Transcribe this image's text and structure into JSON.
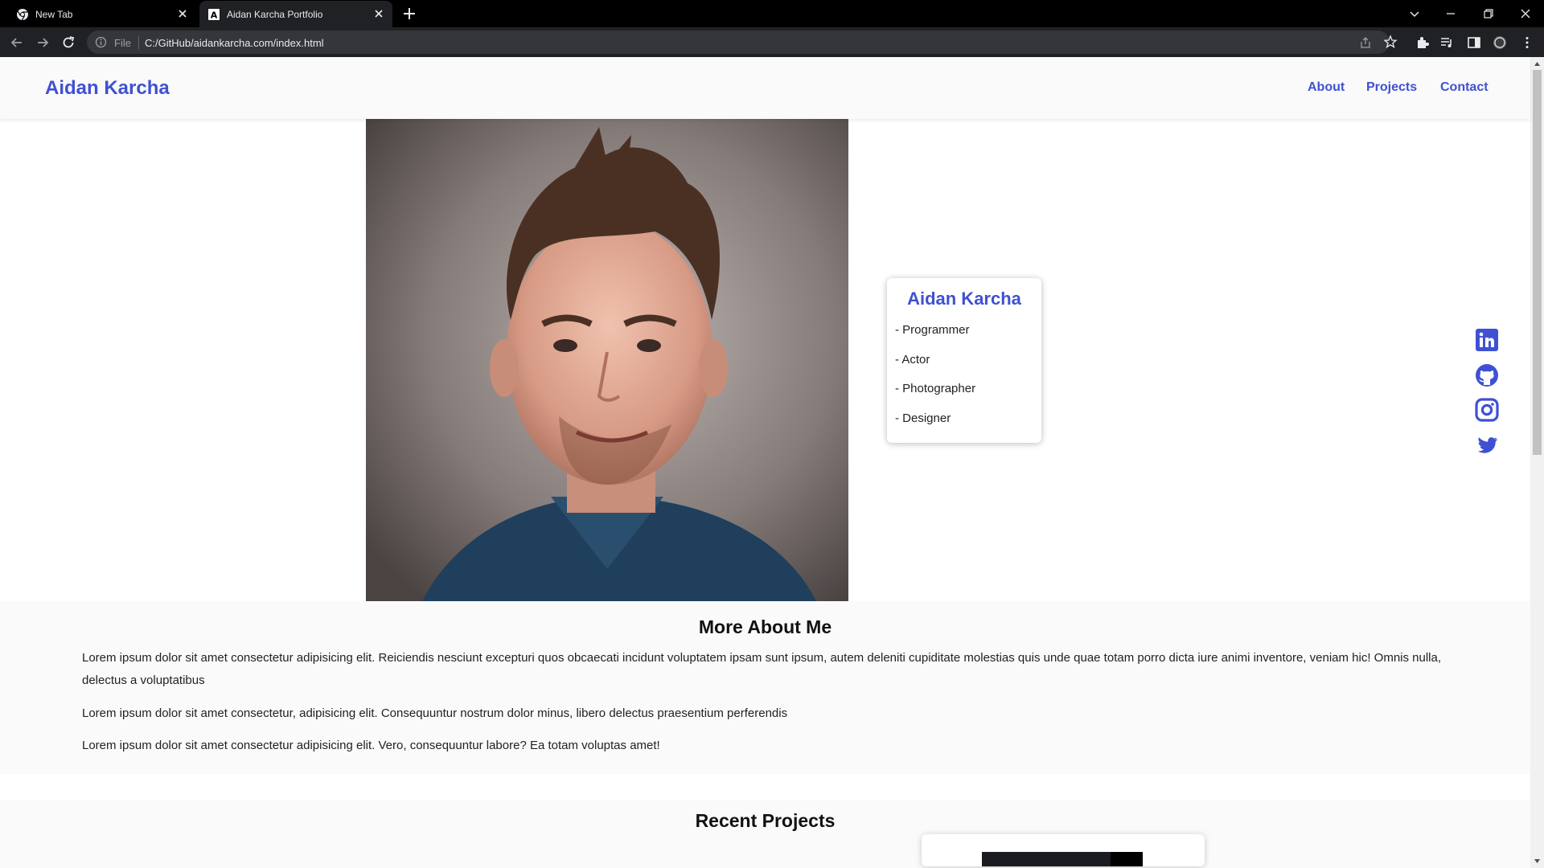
{
  "browser": {
    "tabs": [
      {
        "title": "New Tab",
        "active": false
      },
      {
        "title": "Aidan Karcha Portfolio",
        "active": true
      }
    ],
    "address": {
      "scheme_label": "File",
      "url": "C:/GitHub/aidankarcha.com/index.html"
    }
  },
  "site": {
    "brand": "Aidan Karcha",
    "nav": [
      "About",
      "Projects",
      "Contact"
    ],
    "card": {
      "name": "Aidan Karcha",
      "roles": [
        "- Programmer",
        "- Actor",
        "- Photographer",
        "- Designer"
      ]
    },
    "social": [
      "linkedin-icon",
      "github-icon",
      "instagram-icon",
      "twitter-icon"
    ],
    "about": {
      "title": "More About Me",
      "paragraphs": [
        "Lorem ipsum dolor sit amet consectetur adipisicing elit. Reiciendis nesciunt excepturi quos obcaecati incidunt voluptatem ipsam sunt ipsum, autem deleniti cupiditate molestias quis unde quae totam porro dicta iure animi inventore, veniam hic! Omnis nulla, delectus a voluptatibus",
        "Lorem ipsum dolor sit amet consectetur, adipisicing elit. Consequuntur nostrum dolor minus, libero delectus praesentium perferendis",
        "Lorem ipsum dolor sit amet consectetur adipisicing elit. Vero, consequuntur labore? Ea totam voluptas amet!"
      ]
    },
    "projects": {
      "title": "Recent Projects"
    }
  },
  "colors": {
    "accent": "#3f51d2",
    "chrome_dark": "#202124",
    "tabbar": "#000000",
    "page_bg": "#fafafa"
  }
}
